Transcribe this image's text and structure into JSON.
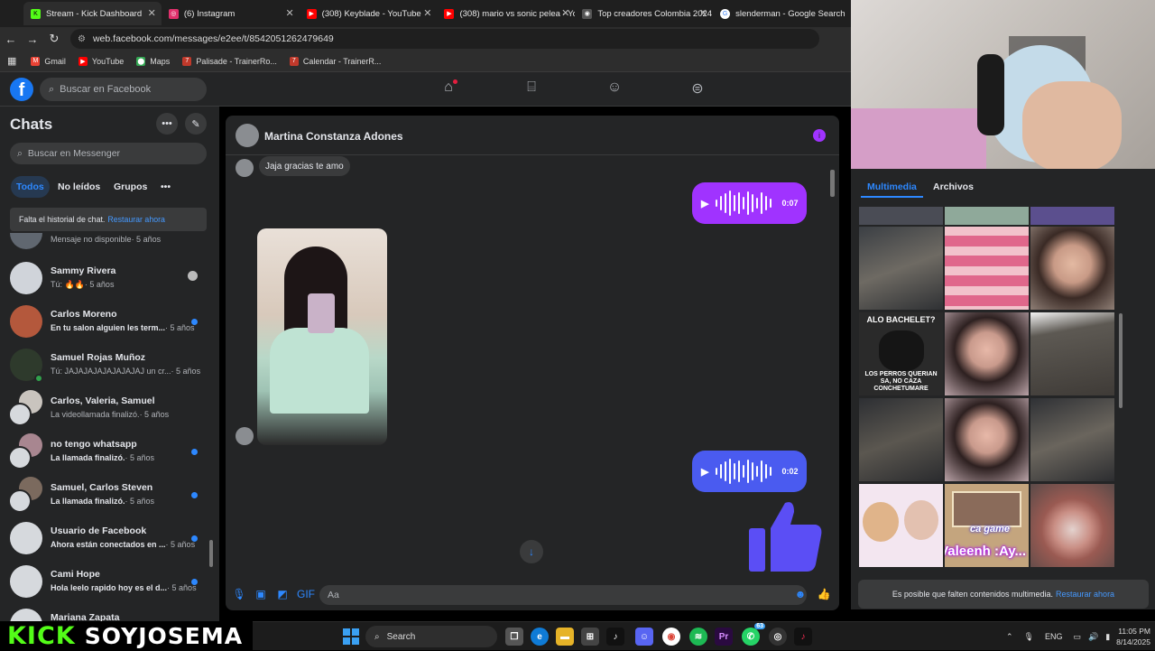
{
  "tabs": [
    {
      "label": "Stream - Kick Dashboard",
      "icon": "kick-icon",
      "color": "#53fc18"
    },
    {
      "label": "(6) Instagram",
      "icon": "instagram-icon",
      "color": "#e1306c"
    },
    {
      "label": "(308) Keyblade - YouTube",
      "icon": "youtube-icon",
      "color": "#ff0000"
    },
    {
      "label": "(308) mario vs sonic pelea - Yo",
      "icon": "youtube-icon",
      "color": "#ff0000"
    },
    {
      "label": "Top creadores Colombia 2024",
      "icon": "globe-icon",
      "color": "#888888"
    },
    {
      "label": "slenderman - Google Search",
      "icon": "google-icon",
      "color": "#4285f4"
    }
  ],
  "address": {
    "url": "web.facebook.com/messages/e2ee/t/8542051262479649"
  },
  "bookmarks": [
    {
      "label": "Gmail",
      "icon": "gmail-icon",
      "color": "#ea4335"
    },
    {
      "label": "YouTube",
      "icon": "youtube-icon",
      "color": "#ff0000"
    },
    {
      "label": "Maps",
      "icon": "maps-icon",
      "color": "#34a853"
    },
    {
      "label": "Palisade - TrainerRo...",
      "icon": "trainer-icon",
      "color": "#c0392b"
    },
    {
      "label": "Calendar - TrainerR...",
      "icon": "trainer-icon",
      "color": "#c0392b"
    }
  ],
  "fb": {
    "logo": "f",
    "search_placeholder": "Buscar en Facebook"
  },
  "sidebar": {
    "title": "Chats",
    "search_placeholder": "Buscar en Messenger",
    "filters": [
      "Todos",
      "No leídos",
      "Grupos"
    ],
    "history_text": "Falta el historial de chat.",
    "history_link": "Restaurar ahora",
    "chats": [
      {
        "name": "",
        "preview": "Mensaje no disponible",
        "time": "· 5 años",
        "unread": false
      },
      {
        "name": "Sammy Rivera",
        "preview": "Tú: 🔥🔥",
        "time": "· 5 años",
        "unread": false
      },
      {
        "name": "Carlos Moreno",
        "preview": "En tu salon alguien les term...",
        "time": "· 5 años",
        "unread": true
      },
      {
        "name": "Samuel Rojas Muñoz",
        "preview": "Tú: JAJAJAJAJAJAJAJAJ un cr...",
        "time": "· 5 años",
        "unread": false
      },
      {
        "name": "Carlos, Valeria, Samuel",
        "preview": "La videollamada finalizó.",
        "time": "· 5 años",
        "unread": false
      },
      {
        "name": "no tengo whatsapp",
        "preview": "La llamada finalizó.",
        "time": "· 5 años",
        "unread": true
      },
      {
        "name": "Samuel, Carlos Steven",
        "preview": "La llamada finalizó.",
        "time": "· 5 años",
        "unread": true
      },
      {
        "name": "Usuario de Facebook",
        "preview": "Ahora están conectados en ...",
        "time": "· 5 años",
        "unread": true
      },
      {
        "name": "Cami Hope",
        "preview": "Hola leelo rapido hoy es el d...",
        "time": "· 5 años",
        "unread": true
      },
      {
        "name": "Mariana Zapata",
        "preview": "",
        "time": "",
        "unread": false
      }
    ]
  },
  "conversation": {
    "contact": "Martina Constanza Adones",
    "received_text": "Jaja gracias te amo",
    "voice1": {
      "duration": "0:07",
      "color": "#a033ff"
    },
    "voice2": {
      "duration": "0:02",
      "color": "#4a5bf0"
    },
    "composer_placeholder": "Aa"
  },
  "media_panel": {
    "tabs": [
      "Multimedia",
      "Archivos"
    ],
    "meme_top": "ALO BACHELET?",
    "meme_bottom": "LOS PERROS QUERIAN SA, NO CAZA CONCHETUMARE",
    "sticker_text": "Valeenh :Ay...",
    "game_text": "ca game",
    "notice": "Es posible que falten contenidos multimedia.",
    "notice_link": "Restaurar ahora"
  },
  "stream_overlay": {
    "kick": "KICK",
    "user": "SOYJOSEMA"
  },
  "taskbar": {
    "search_placeholder": "Search",
    "lang": "ENG",
    "time": "11:05 PM",
    "date": "8/14/2025",
    "badge": "63"
  }
}
